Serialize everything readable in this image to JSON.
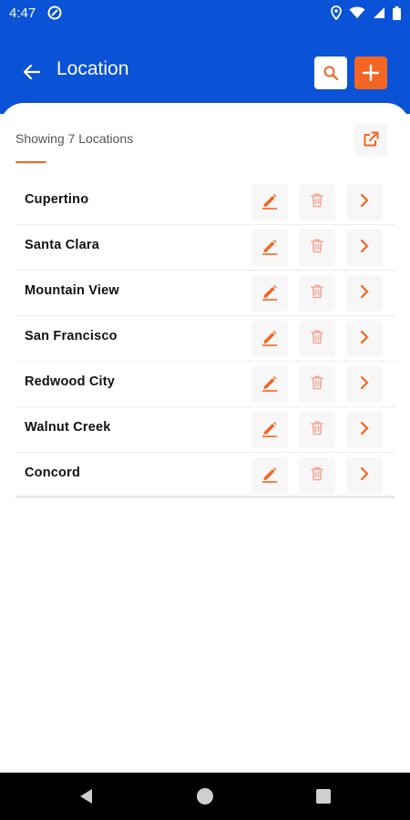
{
  "status_bar": {
    "time": "4:47",
    "icons": [
      "do-not-disturb-icon",
      "location-pin-icon",
      "wifi-icon",
      "signal-icon",
      "battery-icon"
    ]
  },
  "app_bar": {
    "title": "Location",
    "back_icon": "arrow-left-icon",
    "search_icon": "search-icon",
    "add_icon": "plus-icon"
  },
  "list": {
    "count_label": "Showing 7 Locations",
    "export_icon": "open-external-icon",
    "items": [
      {
        "name": "Cupertino"
      },
      {
        "name": "Santa Clara"
      },
      {
        "name": "Mountain View"
      },
      {
        "name": "San Francisco"
      },
      {
        "name": "Redwood City"
      },
      {
        "name": "Walnut Creek"
      },
      {
        "name": "Concord"
      }
    ],
    "row_icons": {
      "edit": "pencil-icon",
      "delete": "trash-icon",
      "open": "chevron-right-icon"
    }
  },
  "nav_bar": {
    "icons": [
      "back-triangle-icon",
      "home-circle-icon",
      "recents-square-icon"
    ]
  },
  "colors": {
    "primary": "#0a52d6",
    "accent": "#f26522",
    "delete_tint": "#f3a593"
  }
}
